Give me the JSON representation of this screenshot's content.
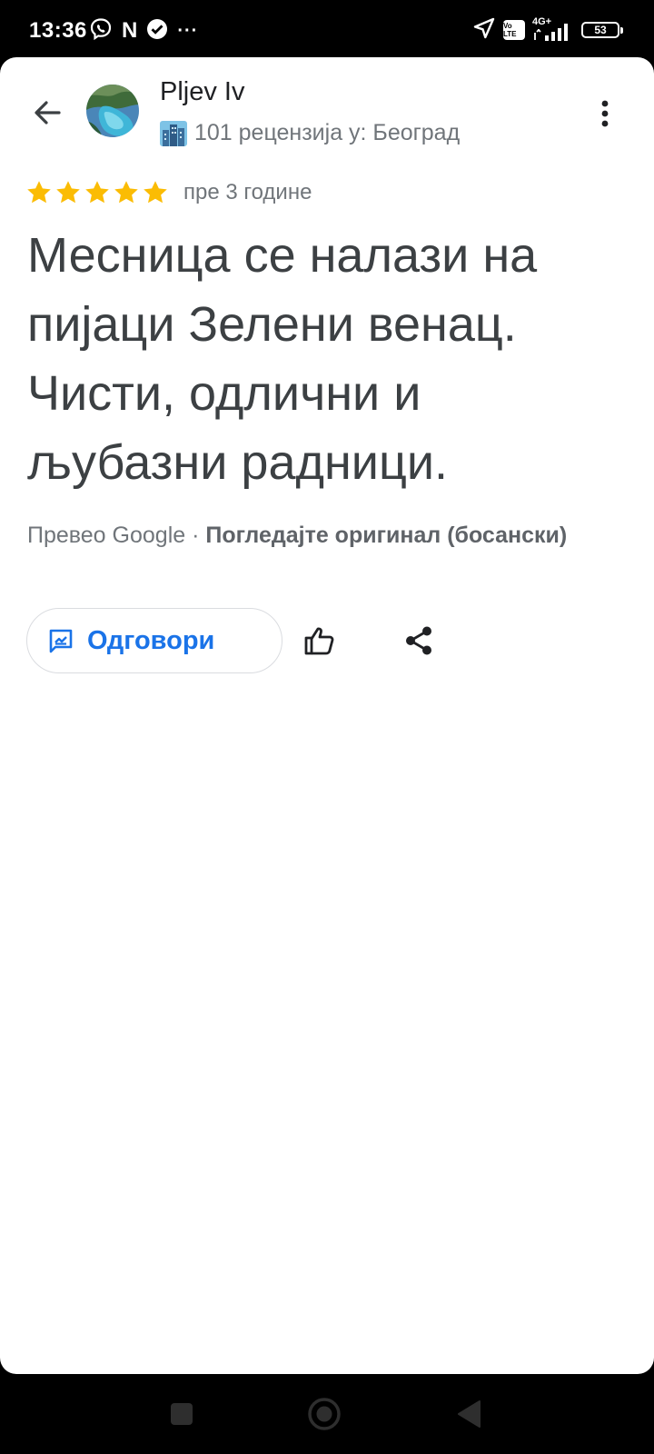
{
  "status_bar": {
    "time": "13:36",
    "left_icons": [
      "viber-icon",
      "netflix-icon",
      "check-circle-icon",
      "more-notifications-icon"
    ],
    "netflix_letter": "N",
    "more_notifications": "···",
    "network_label": "4G+",
    "volte_label": "Vo LTE",
    "battery": "53"
  },
  "header": {
    "user_name": "Pljev Iv",
    "review_meta": "101 рецензија у: Београд"
  },
  "review": {
    "rating": 5,
    "rating_max": 5,
    "time": "пре 3 године",
    "text": "Месница се налази на пијаци Зелени венац. Чисти, одлични и љубазни радници.",
    "translated_by": "Превео Google",
    "separator": " · ",
    "original_link": "Погледајте оригинал (босански)"
  },
  "actions": {
    "reply_label": "Одговори"
  },
  "colors": {
    "accent": "#1a73e8",
    "star": "#fbbc04",
    "text_primary": "#3c4043",
    "text_secondary": "#70757a"
  }
}
